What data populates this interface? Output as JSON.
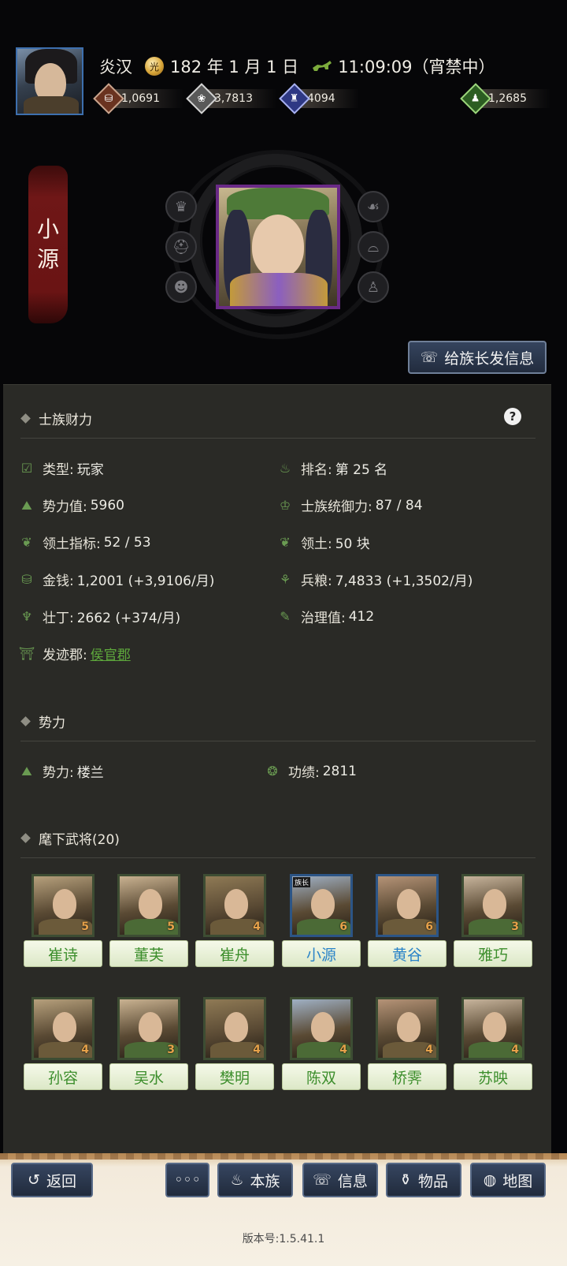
{
  "header": {
    "faction": "炎汉",
    "date": "182 年 1 月 1 日",
    "time": "11:09:09（宵禁中）",
    "date_icon_glyph": "光",
    "resources": [
      {
        "icon": "coin-stack-icon",
        "glyph": "⛁",
        "value": "1,0691",
        "color": "#a15a3c"
      },
      {
        "icon": "grain-icon",
        "glyph": "❀",
        "value": "3,7813",
        "color": "#a9a9a9"
      },
      {
        "icon": "soldier-icon",
        "glyph": "♜",
        "value": "4094",
        "color": "#4a58b8"
      }
    ],
    "extra_resource": {
      "icon": "money-bag-icon",
      "glyph": "♟",
      "value": "1,2685",
      "color": "#3f8a2e"
    }
  },
  "character": {
    "name_line1": "小",
    "name_line2": "源",
    "side_icons_left": [
      {
        "name": "crown-icon",
        "glyph": "♛"
      },
      {
        "name": "helmet-icon",
        "glyph": "⛑"
      },
      {
        "name": "mask-icon",
        "glyph": "☻"
      }
    ],
    "side_icons_right": [
      {
        "name": "hand-seed-icon",
        "glyph": "☙"
      },
      {
        "name": "hat-icon",
        "glyph": "⌓"
      },
      {
        "name": "graduation-cap-icon",
        "glyph": "♙"
      }
    ],
    "send_button_label": "给族长发信息"
  },
  "clan_finance": {
    "title": "士族财力",
    "help_glyph": "?",
    "stats_left": [
      {
        "label": "类型:",
        "value": "玩家",
        "icon": "check-calendar-icon",
        "glyph": "☑"
      },
      {
        "label": "势力值:",
        "value": "5960",
        "icon": "mountain-icon",
        "glyph": "⛰"
      },
      {
        "label": "领土指标:",
        "value": "52 / 53",
        "icon": "territory-icon",
        "glyph": "❦"
      },
      {
        "label": "金钱:",
        "value": "1,2001 (+3,9106/月)",
        "icon": "coins-icon",
        "glyph": "⛁"
      },
      {
        "label": "壮丁:",
        "value": "2662 (+374/月)",
        "icon": "strongman-icon",
        "glyph": "♆"
      },
      {
        "label": "发迹郡:",
        "value": "侯官郡",
        "icon": "gate-icon",
        "glyph": "⛩"
      }
    ],
    "stats_right": [
      {
        "label": "排名:",
        "value": "第 25 名",
        "icon": "rank-icon",
        "glyph": "♨"
      },
      {
        "label": "士族统御力:",
        "value": "87 / 84",
        "icon": "leader-icon",
        "glyph": "♔"
      },
      {
        "label": "领土:",
        "value": "50 块",
        "icon": "land-icon",
        "glyph": "❦"
      },
      {
        "label": "兵粮:",
        "value": "7,4833 (+1,3502/月)",
        "icon": "wheat-icon",
        "glyph": "⚘"
      },
      {
        "label": "治理值:",
        "value": "412",
        "icon": "governance-icon",
        "glyph": "✎"
      }
    ]
  },
  "force": {
    "title": "势力",
    "force_label": "势力:",
    "force_value": "楼兰",
    "merit_label": "功绩:",
    "merit_value": "2811"
  },
  "generals": {
    "title": "麾下武将(20)",
    "leader_tag": "族长",
    "row1": [
      {
        "name": "崔诗",
        "cost": "5",
        "blue": false
      },
      {
        "name": "董芙",
        "cost": "5",
        "blue": false
      },
      {
        "name": "崔舟",
        "cost": "4",
        "blue": false
      },
      {
        "name": "小源",
        "cost": "6",
        "blue": true,
        "leader": true
      },
      {
        "name": "黄谷",
        "cost": "6",
        "blue": true
      },
      {
        "name": "雅巧",
        "cost": "3",
        "blue": false
      }
    ],
    "row2": [
      {
        "name": "孙容",
        "cost": "4",
        "blue": false
      },
      {
        "name": "吴水",
        "cost": "3",
        "blue": false
      },
      {
        "name": "樊明",
        "cost": "4",
        "blue": false
      },
      {
        "name": "陈双",
        "cost": "4",
        "blue": false
      },
      {
        "name": "桥霁",
        "cost": "4",
        "blue": false
      },
      {
        "name": "苏映",
        "cost": "4",
        "blue": false
      }
    ]
  },
  "bottom_nav": {
    "back": "返回",
    "more": "◦◦◦",
    "clan": "本族",
    "info": "信息",
    "items": "物品",
    "map": "地图",
    "version": "版本号:1.5.41.1"
  },
  "colors": {
    "accent_green": "#5ea83c",
    "nav_blue": "#364560",
    "panel": "#2a2a26",
    "banner_red": "#6f1717"
  }
}
